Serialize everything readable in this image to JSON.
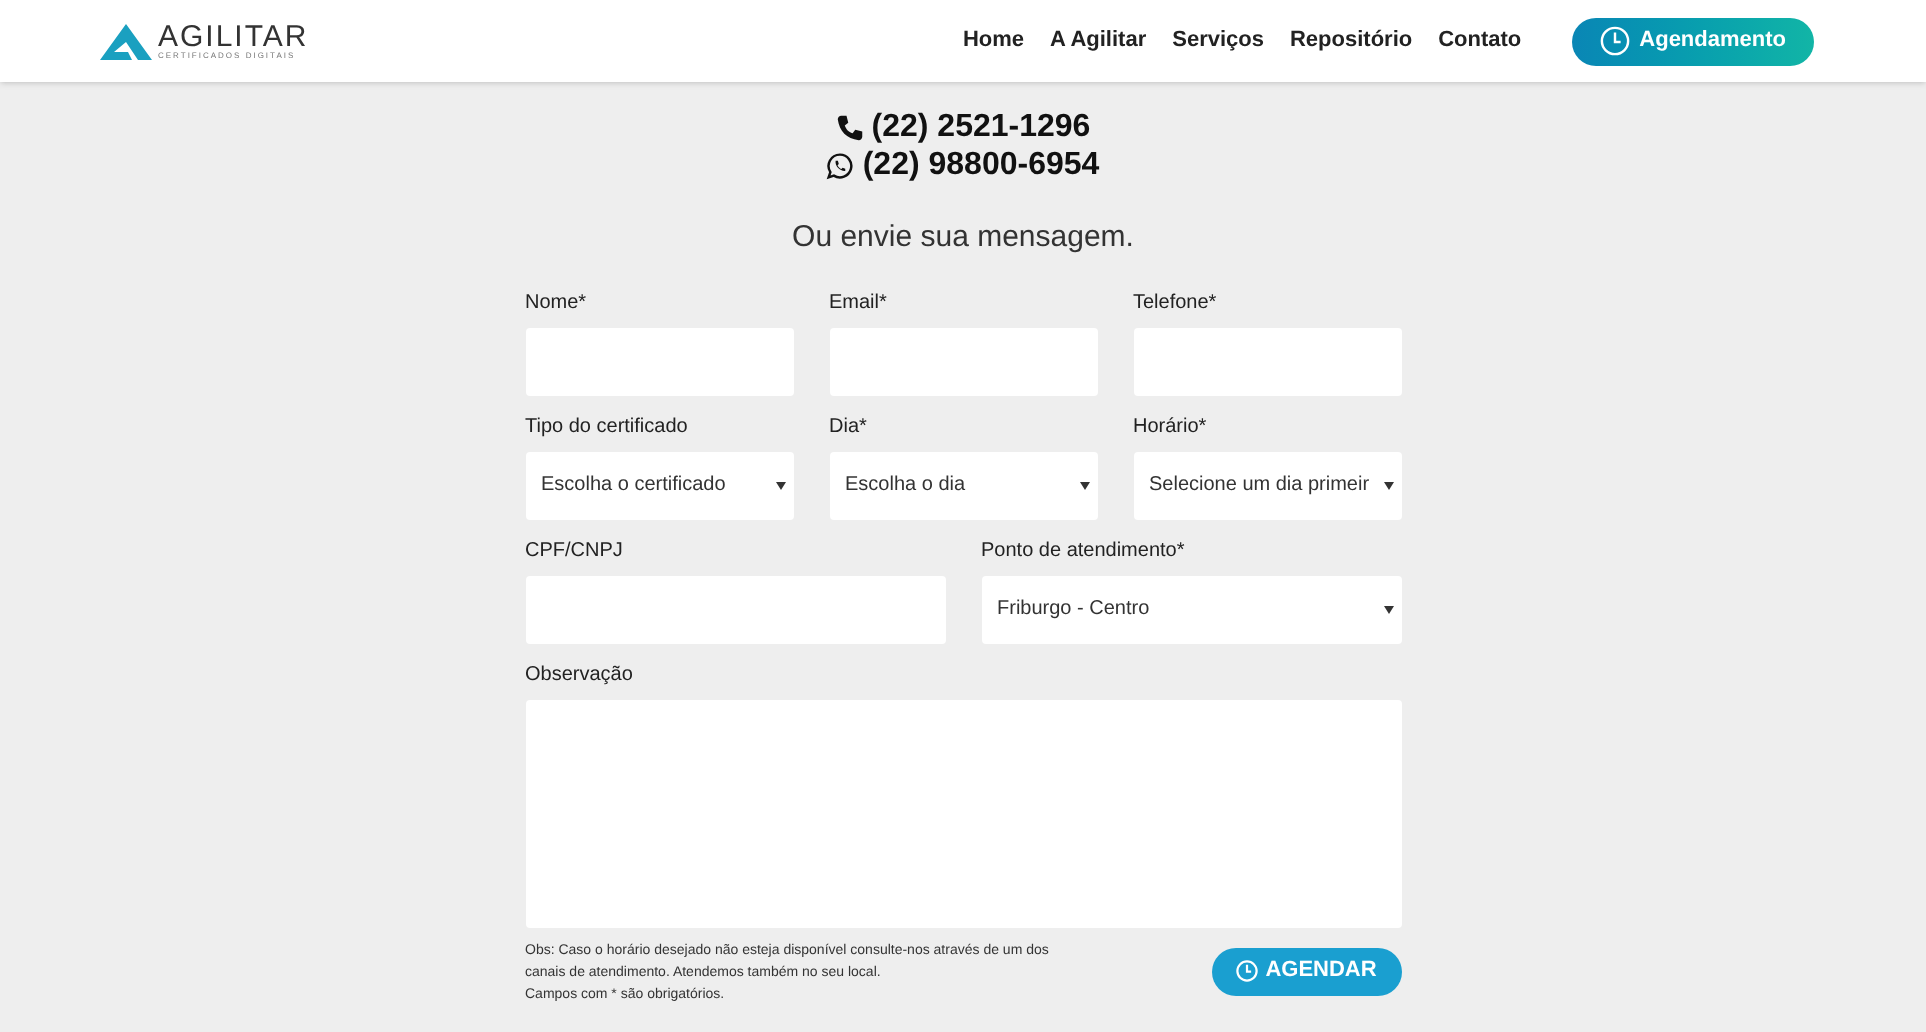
{
  "logo": {
    "name": "AGILITAR",
    "tagline": "CERTIFICADOS DIGITAIS"
  },
  "nav": [
    {
      "label": "Home"
    },
    {
      "label": "A Agilitar"
    },
    {
      "label": "Serviços"
    },
    {
      "label": "Repositório"
    },
    {
      "label": "Contato"
    }
  ],
  "cta": {
    "label": "Agendamento"
  },
  "phones": [
    {
      "kind": "phone",
      "number": "(22) 2521-1296"
    },
    {
      "kind": "whatsapp",
      "number": "(22) 98800-6954"
    }
  ],
  "heading": "Ou envie sua mensagem.",
  "form_rows": [
    [
      {
        "kind": "text",
        "label": "Nome*"
      },
      {
        "kind": "text",
        "label": "Email*"
      },
      {
        "kind": "text",
        "label": "Telefone*"
      }
    ],
    [
      {
        "kind": "select",
        "label": "Tipo do certificado",
        "value": "Escolha o certificado"
      },
      {
        "kind": "select",
        "label": "Dia*",
        "value": "Escolha o dia"
      },
      {
        "kind": "select",
        "label": "Horário*",
        "value": "Selecione um dia primeir"
      }
    ],
    [
      {
        "kind": "text",
        "label": "CPF/CNPJ"
      },
      {
        "kind": "select",
        "label": "Ponto de atendimento*",
        "value": "Friburgo - Centro"
      }
    ],
    [
      {
        "kind": "textarea",
        "label": "Observação"
      }
    ]
  ],
  "notes": [
    "Obs: Caso o horário desejado não esteja disponível consulte-nos através de um dos canais de atendimento. Atendemos também no seu local.",
    "Campos com * são obrigatórios."
  ],
  "submit": {
    "label": "AGENDAR"
  }
}
